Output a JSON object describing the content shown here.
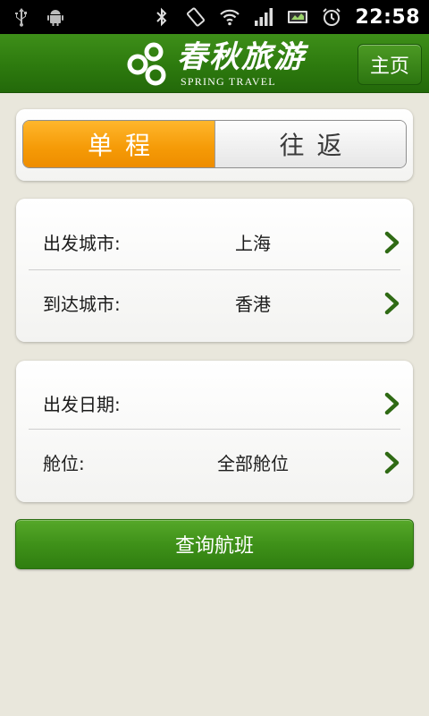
{
  "status_bar": {
    "time": "22:58",
    "icons_left": [
      "usb-icon",
      "android-debug-icon"
    ],
    "icons_right": [
      "bluetooth-icon",
      "rotate-icon",
      "wifi-icon",
      "signal-icon",
      "battery-icon",
      "alarm-icon"
    ]
  },
  "header": {
    "logo_cn": "春秋旅游",
    "logo_en": "SPRING TRAVEL",
    "home_label": "主页"
  },
  "trip_type": {
    "options": [
      "单程",
      "往返"
    ],
    "selected": "单程"
  },
  "city_form": {
    "departure_label": "出发城市:",
    "departure_value": "上海",
    "arrival_label": "到达城市:",
    "arrival_value": "香港"
  },
  "date_form": {
    "date_label": "出发日期:",
    "date_value": "",
    "cabin_label": "舱位:",
    "cabin_value": "全部舱位"
  },
  "search_button_label": "查询航班",
  "colors": {
    "header_green": "#2d7a0e",
    "active_orange": "#f59a06",
    "button_green": "#3f9119",
    "background": "#e9e7dc"
  }
}
